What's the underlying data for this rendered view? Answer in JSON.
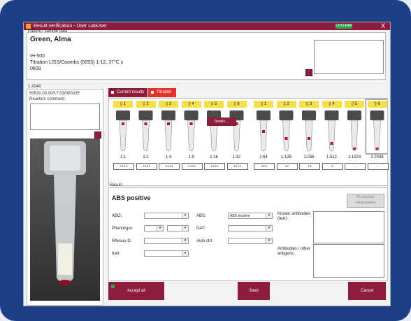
{
  "window": {
    "title": "Result verification - User LabUser",
    "badge": "CITO-RAP",
    "close": "X"
  },
  "patient": {
    "section_label": "Patient / sample data",
    "name": "Green, Alma",
    "id": "IH-500",
    "test": "Titration LISS/Coombs (5053) 1-12, 37°C x",
    "code": "0609"
  },
  "left_panel": {
    "section_label": "1:2048",
    "sample_id": "50530.00.00/17.03/000025",
    "reaction_comment_label": "Reaction comment:"
  },
  "tabs": [
    {
      "label": "Current results",
      "color": "#8e1c3d"
    },
    {
      "label": "Titration",
      "color": "#e0332b"
    }
  ],
  "wells": [
    {
      "header": "1",
      "ratio": "1:1",
      "grade": "++++",
      "level": 0
    },
    {
      "header": "2",
      "ratio": "1:2",
      "grade": "++++",
      "level": 0
    },
    {
      "header": "3",
      "ratio": "1:4",
      "grade": "++++",
      "level": 0
    },
    {
      "header": "4",
      "ratio": "1:8",
      "grade": "++++",
      "level": 0
    },
    {
      "header": "5",
      "ratio": "1:16",
      "grade": "++++",
      "level": 0
    },
    {
      "header": "6",
      "ratio": "1:32",
      "grade": "++++",
      "level": 0
    },
    {
      "header": "1",
      "ratio": "1:64",
      "grade": "+++",
      "level": 1
    },
    {
      "header": "2",
      "ratio": "1:128",
      "grade": "++",
      "level": 2
    },
    {
      "header": "3",
      "ratio": "1:256",
      "grade": "++",
      "level": 2
    },
    {
      "header": "4",
      "ratio": "1:512",
      "grade": "+",
      "level": 3
    },
    {
      "header": "5",
      "ratio": "1:1024",
      "grade": "-",
      "level": 4
    },
    {
      "header": "6",
      "ratio": "1:2048",
      "grade": "-",
      "level": 4
    }
  ],
  "result": {
    "section_label": "Result",
    "value": "ABS positive",
    "recalc_button": "Recalculate interpretation",
    "abo_label": "ABO:",
    "phenotype_label": "Phenotype:",
    "rhesus_label": "Rhesus-D:",
    "kell_label": "Kell:",
    "abs_label": "ABS:",
    "abs_value": "ABS positive",
    "dat_label": "DAT:",
    "autoctrl_label": "Auto ctrl :",
    "known_antibodies_label": "Known antibodies (text):",
    "antibodies_label": "Antibodies / other antigens:",
    "details_button": "Details ..."
  },
  "footer": {
    "accept": "Accept all",
    "save": "Save",
    "cancel": "Cancel"
  }
}
